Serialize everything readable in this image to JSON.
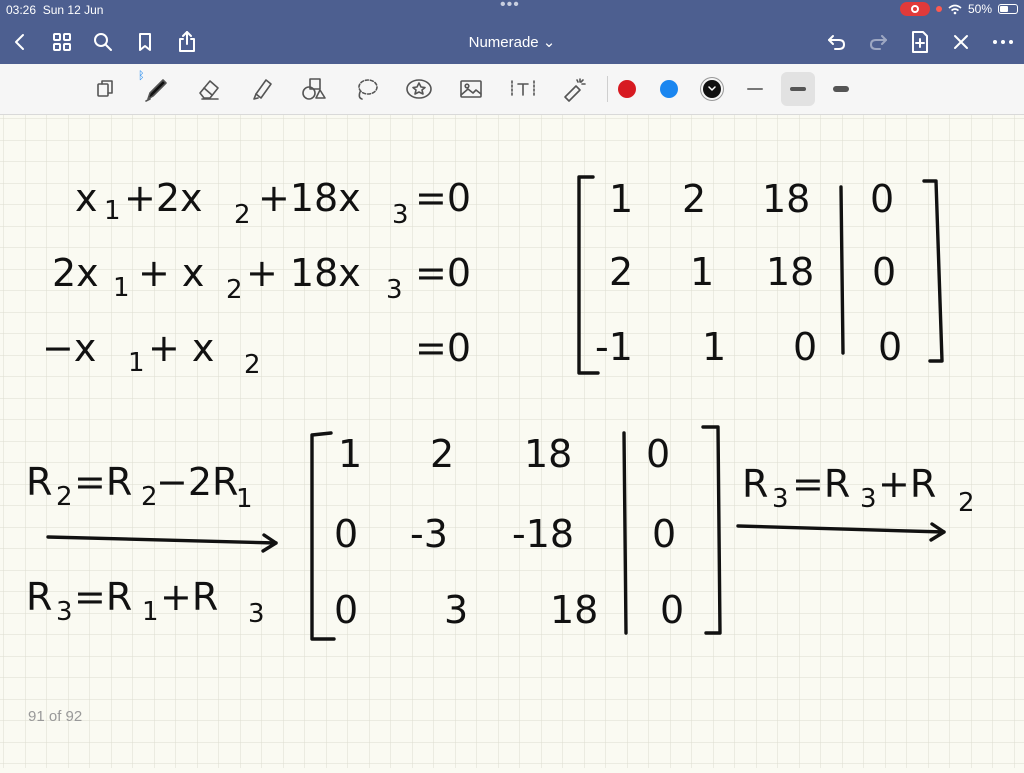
{
  "status_bar": {
    "time": "03:26",
    "date": "Sun 12 Jun",
    "battery": "50%"
  },
  "nav": {
    "title": "Numerade ⌄"
  },
  "toolbar": {
    "tools": [
      "lasso-icon",
      "pen-icon",
      "eraser-icon",
      "highlighter-icon",
      "shapes-icon",
      "lasso-select-icon",
      "sticker-icon",
      "image-icon",
      "text-icon",
      "laser-pointer-icon"
    ],
    "colors": [
      "#d71a21",
      "#1a86f0",
      "#111111"
    ],
    "stroke_widths": [
      "thin",
      "medium",
      "thick"
    ],
    "selected_stroke": "medium"
  },
  "page_indicator": "91 of 92",
  "equations": {
    "eq1": {
      "l1": "x",
      "s1": "1",
      "l2": "+2x",
      "s2": "2",
      "l3": "+18x",
      "s3": "3",
      "r": "=0"
    },
    "eq2": {
      "l1": "2x",
      "s1": "1",
      "l2": "+ x",
      "s2": "2",
      "l3": "+ 18x",
      "s3": "3",
      "r": "=0"
    },
    "eq3": {
      "l1": "−x",
      "s1": "1",
      "l2": "+ x",
      "s2": "2",
      "r": "=0"
    }
  },
  "matrix1": [
    [
      "1",
      "2",
      "18",
      "0"
    ],
    [
      "2",
      "1",
      "18",
      "0"
    ],
    [
      "-1",
      "1",
      "0",
      "0"
    ]
  ],
  "op1": {
    "l": "R",
    "s": "2",
    "m": "=R",
    "s2": "2",
    "r": "−2R",
    "s3": "1"
  },
  "op2": {
    "l": "R",
    "s": "3",
    "m": "=R",
    "s2": "1",
    "r": "+R",
    "s3": "3"
  },
  "matrix2": [
    [
      "1",
      "2",
      "18",
      "0"
    ],
    [
      "0",
      "-3",
      "-18",
      "0"
    ],
    [
      "0",
      "3",
      "18",
      "0"
    ]
  ],
  "op3": {
    "l": "R",
    "s": "3",
    "m": "=R",
    "s2": "3",
    "r": "+R",
    "s3": "2"
  }
}
